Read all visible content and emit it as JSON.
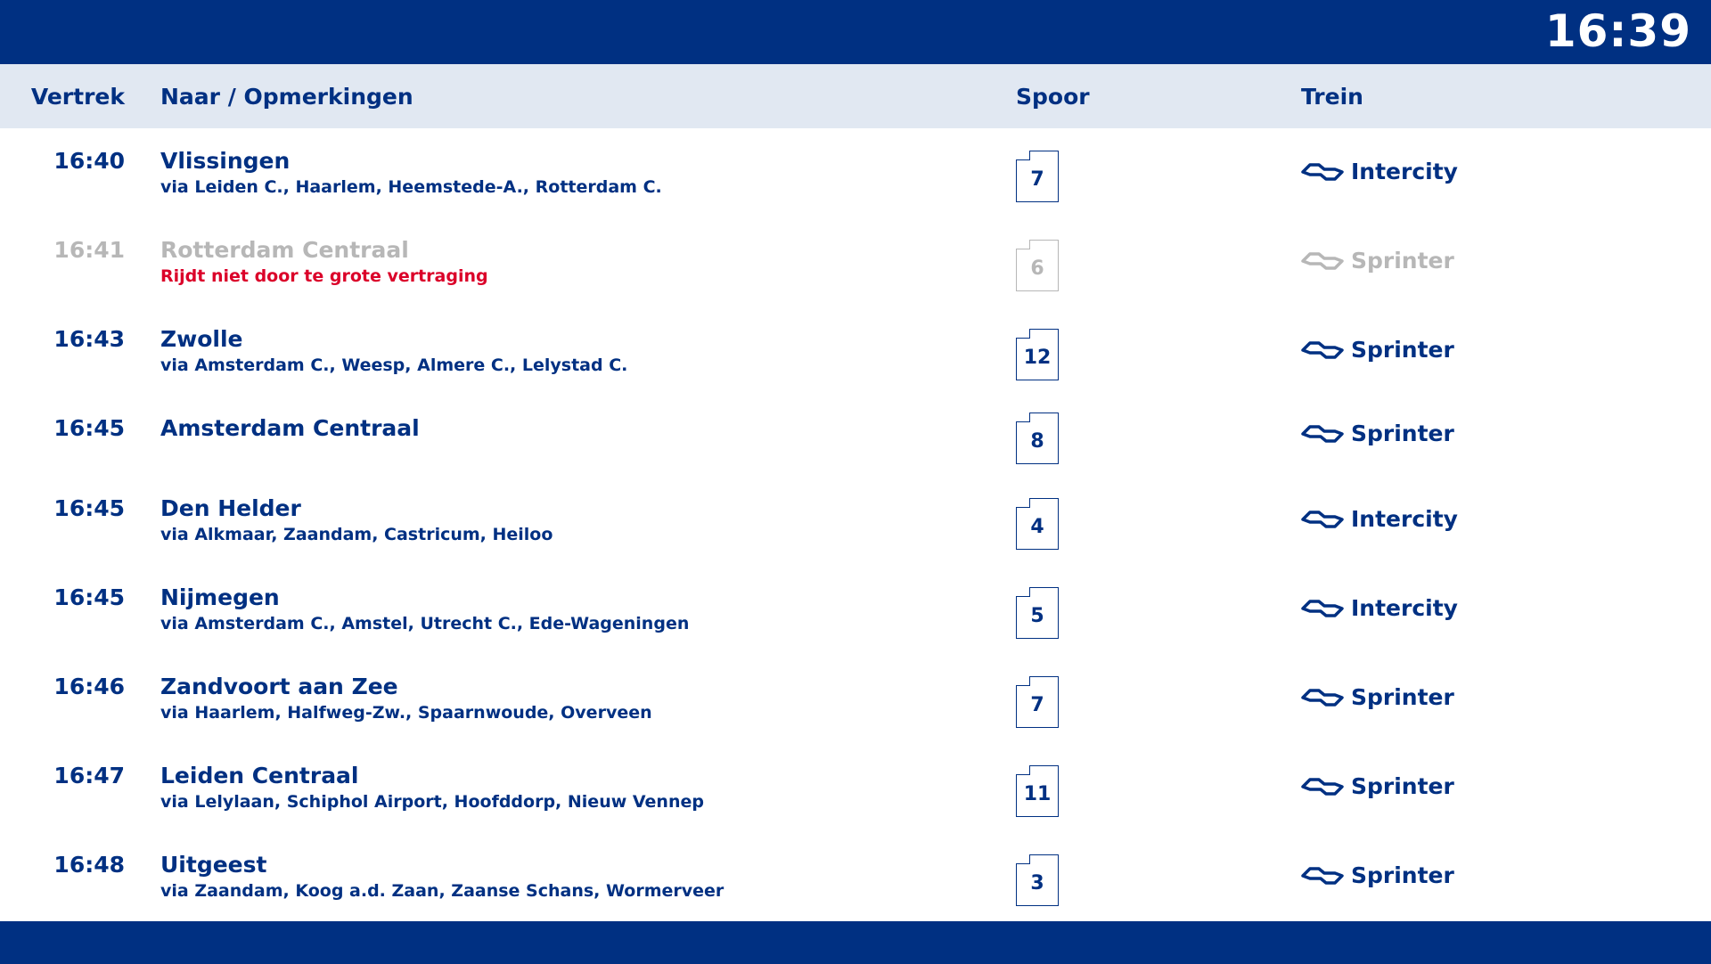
{
  "clock": "16:39",
  "header": {
    "vertrek": "Vertrek",
    "naar": "Naar / Opmerkingen",
    "spoor": "Spoor",
    "trein": "Trein"
  },
  "colors": {
    "brand_blue": "#003082",
    "header_bg": "#e1e8f2",
    "cancelled_gray": "#b7b7b7",
    "alert_red": "#db0029"
  },
  "icons": {
    "train_logo": "ns-logo-icon"
  },
  "departures": [
    {
      "time": "16:40",
      "destination": "Vlissingen",
      "note": "via Leiden C., Haarlem, Heemstede-A., Rotterdam C.",
      "platform": "7",
      "train": "Intercity"
    },
    {
      "time": "16:41",
      "destination": "Rotterdam Centraal",
      "note": "Rijdt niet door te grote vertraging",
      "platform": "6",
      "train": "Sprinter"
    },
    {
      "time": "16:43",
      "destination": "Zwolle",
      "note": "via Amsterdam C., Weesp, Almere C., Lelystad C.",
      "platform": "12",
      "train": "Sprinter"
    },
    {
      "time": "16:45",
      "destination": "Amsterdam Centraal",
      "note": "",
      "platform": "8",
      "train": "Sprinter"
    },
    {
      "time": "16:45",
      "destination": "Den Helder",
      "note": "via Alkmaar, Zaandam, Castricum, Heiloo",
      "platform": "4",
      "train": "Intercity"
    },
    {
      "time": "16:45",
      "destination": "Nijmegen",
      "note": "via Amsterdam C., Amstel, Utrecht C., Ede-Wageningen",
      "platform": "5",
      "train": "Intercity"
    },
    {
      "time": "16:46",
      "destination": "Zandvoort aan Zee",
      "note": "via Haarlem, Halfweg-Zw., Spaarnwoude, Overveen",
      "platform": "7",
      "train": "Sprinter"
    },
    {
      "time": "16:47",
      "destination": "Leiden Centraal",
      "note": "via Lelylaan, Schiphol Airport, Hoofddorp, Nieuw Vennep",
      "platform": "11",
      "train": "Sprinter"
    },
    {
      "time": "16:48",
      "destination": "Uitgeest",
      "note": "via Zaandam, Koog a.d. Zaan, Zaanse Schans, Wormerveer",
      "platform": "3",
      "train": "Sprinter"
    }
  ]
}
